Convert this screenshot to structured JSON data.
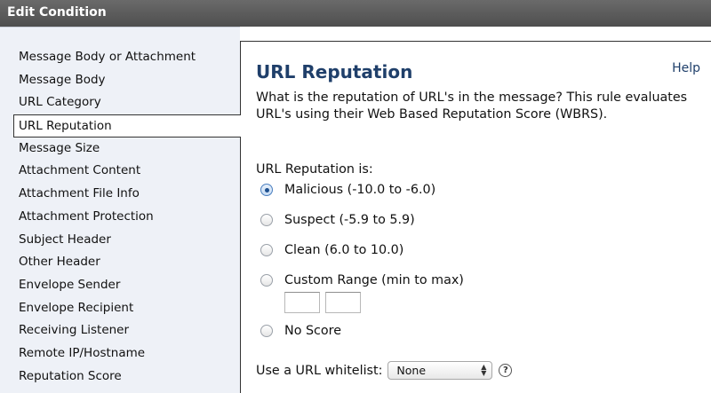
{
  "window": {
    "title": "Edit Condition"
  },
  "sidebar": {
    "items": [
      {
        "label": "Message Body or Attachment",
        "selected": false
      },
      {
        "label": "Message Body",
        "selected": false
      },
      {
        "label": "URL Category",
        "selected": false
      },
      {
        "label": "URL Reputation",
        "selected": true
      },
      {
        "label": "Message Size",
        "selected": false
      },
      {
        "label": "Attachment Content",
        "selected": false
      },
      {
        "label": "Attachment File Info",
        "selected": false
      },
      {
        "label": "Attachment Protection",
        "selected": false
      },
      {
        "label": "Subject Header",
        "selected": false
      },
      {
        "label": "Other Header",
        "selected": false
      },
      {
        "label": "Envelope Sender",
        "selected": false
      },
      {
        "label": "Envelope Recipient",
        "selected": false
      },
      {
        "label": "Receiving Listener",
        "selected": false
      },
      {
        "label": "Remote IP/Hostname",
        "selected": false
      },
      {
        "label": "Reputation Score",
        "selected": false
      }
    ]
  },
  "panel": {
    "title": "URL Reputation",
    "help": "Help",
    "description": "What is the reputation of URL's in the message? This rule evaluates URL's using their Web Based Reputation Score (WBRS).",
    "section_label": "URL Reputation is:",
    "options": [
      {
        "label": "Malicious (-10.0 to -6.0)",
        "checked": true
      },
      {
        "label": "Suspect (-5.9 to 5.9)",
        "checked": false
      },
      {
        "label": "Clean (6.0 to 10.0)",
        "checked": false
      },
      {
        "label": "Custom Range (min to max)",
        "checked": false
      },
      {
        "label": "No Score",
        "checked": false
      }
    ],
    "custom_range": {
      "min_value": "",
      "max_value": ""
    },
    "whitelist": {
      "label": "Use a URL whitelist:",
      "selected": "None",
      "help_icon": "question-mark-icon"
    }
  }
}
